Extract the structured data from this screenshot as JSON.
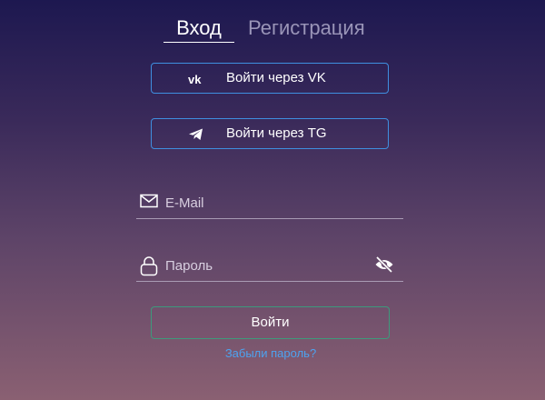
{
  "tabs": {
    "login": "Вход",
    "register": "Регистрация",
    "active": "login"
  },
  "social": {
    "vk_label": "Войти через VK",
    "tg_label": "Войти через TG",
    "vk_icon": "vk-icon",
    "tg_icon": "telegram-icon",
    "border_color": "#3f8fe0"
  },
  "form": {
    "email_placeholder": "E-Mail",
    "email_value": "",
    "password_placeholder": "Пароль",
    "password_value": "",
    "email_icon": "envelope-icon",
    "password_icon": "lock-icon",
    "toggle_icon": "eye-slash-icon"
  },
  "submit": {
    "label": "Войти",
    "border_color": "#3d9a7c"
  },
  "forgot": {
    "label": "Забыли пароль?",
    "color": "#4da3f0"
  }
}
